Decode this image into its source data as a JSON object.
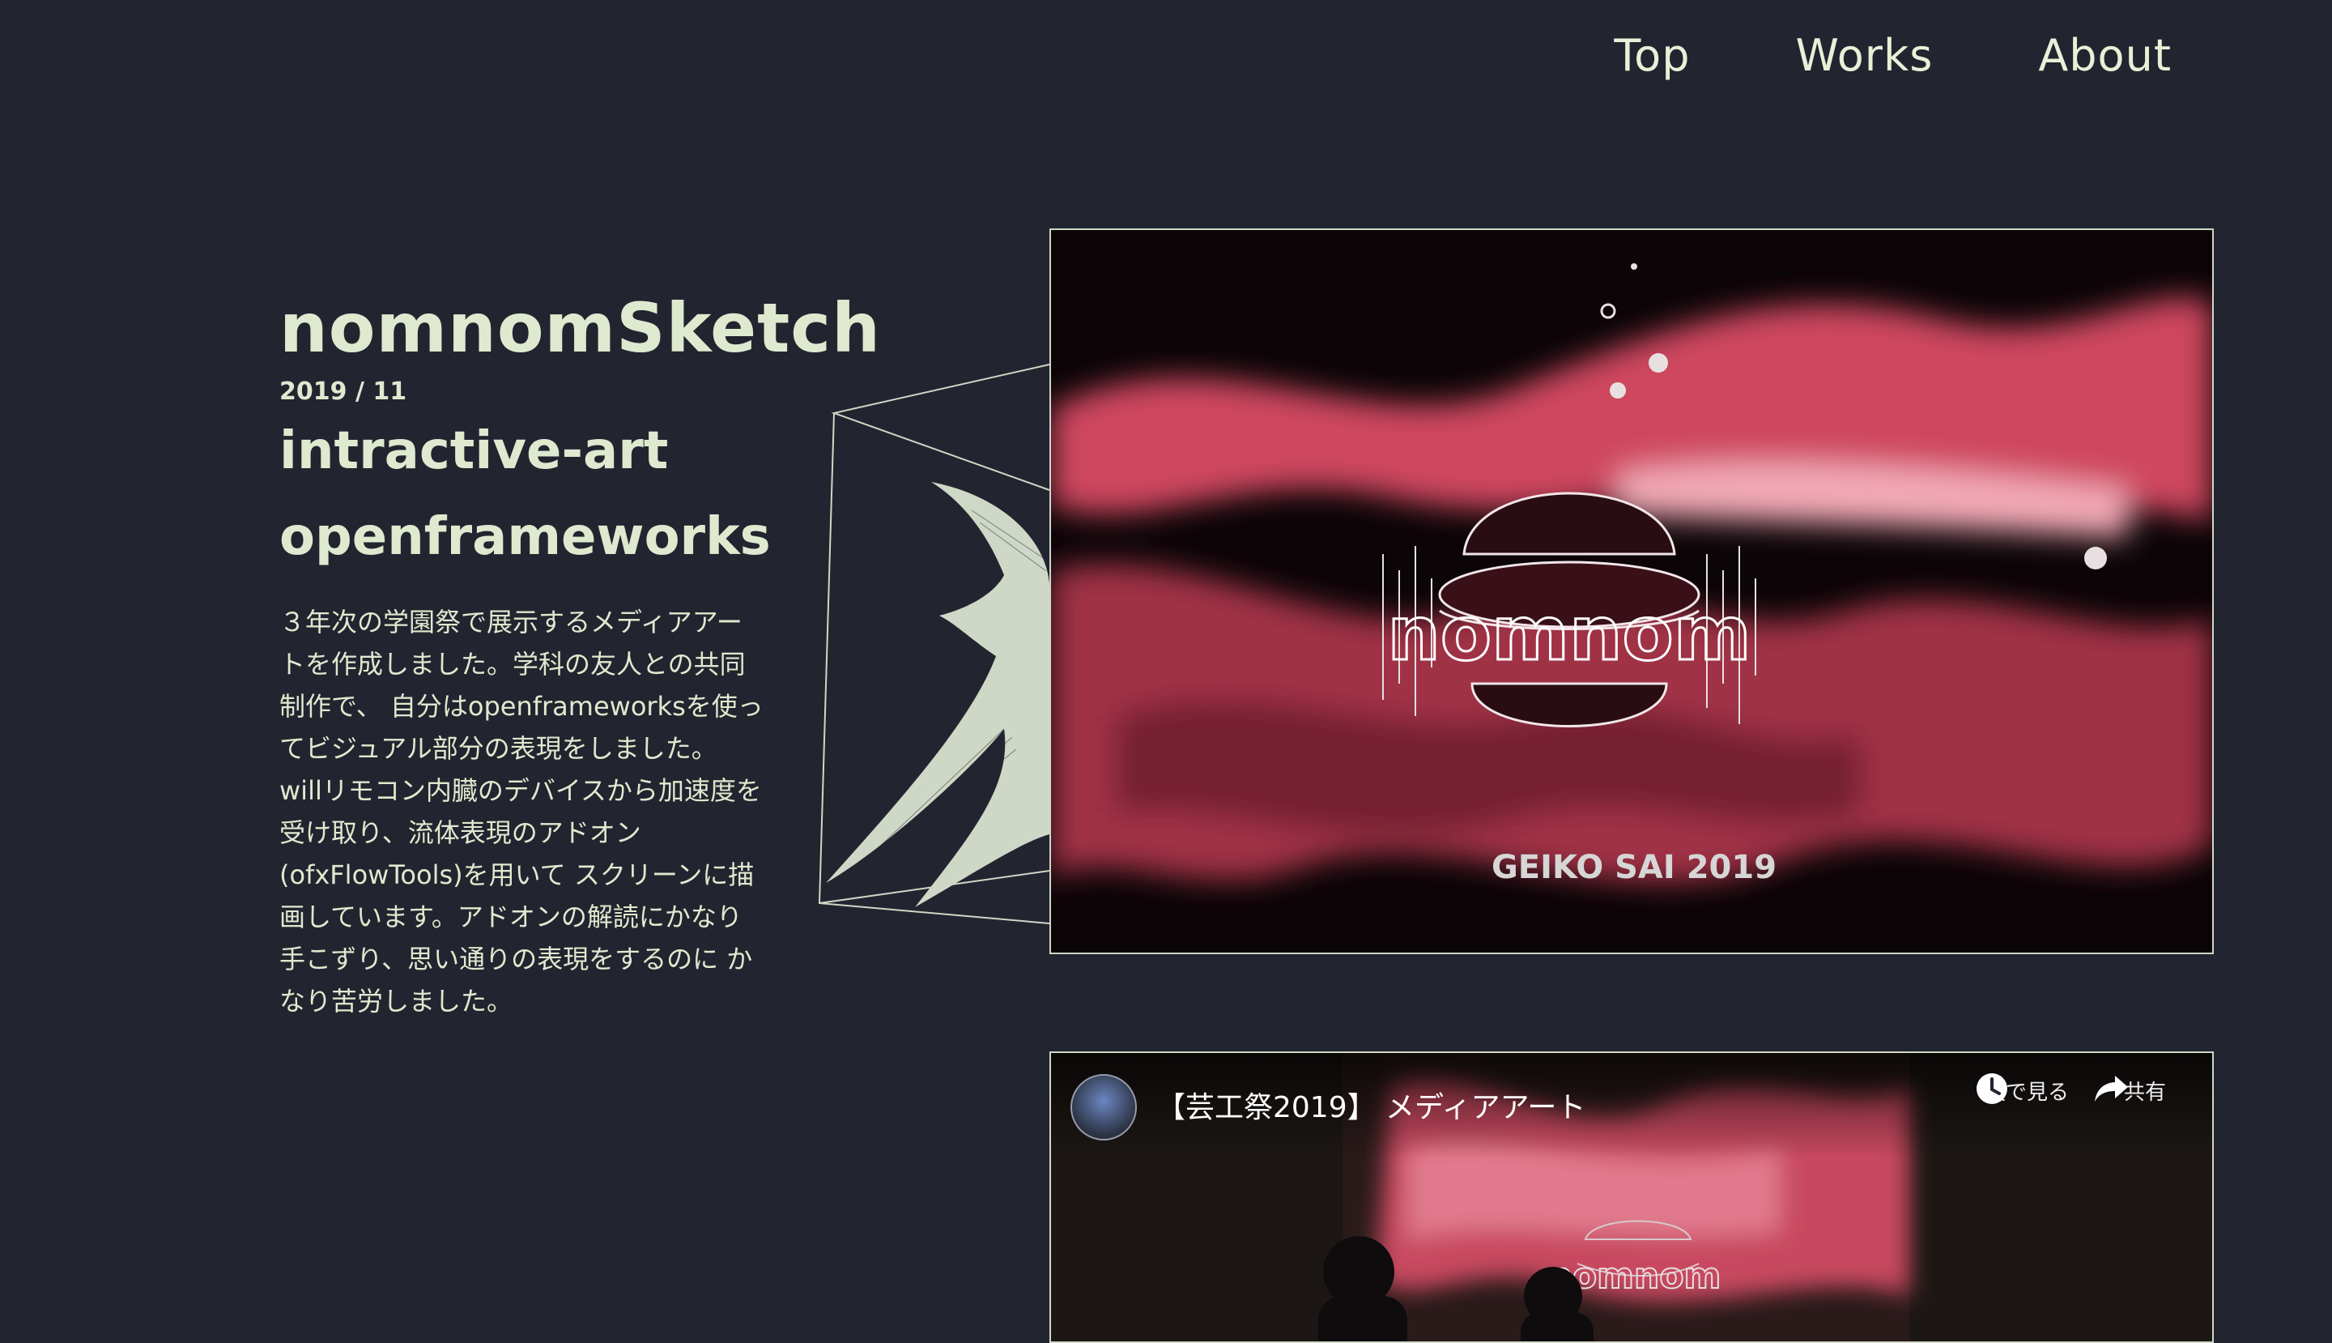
{
  "nav": {
    "items": [
      "Top",
      "Works",
      "About"
    ]
  },
  "work": {
    "title": "nomnomSketch",
    "date": "2019 / 11",
    "tags": [
      "intractive-art",
      "openframeworks"
    ],
    "description_lines": [
      "３年次の学園祭で展示するメディアアー",
      "トを作成しました。学科の友人との共同",
      "制作で、 自分はopenframeworksを使っ",
      "てビジュアル部分の表現をしました。",
      "willリモコン内臓のデバイスから加速度を",
      "受け取り、流体表現のアドオン",
      "(ofxFlowTools)を用いて スクリーンに描",
      "画しています。アドオンの解読にかなり",
      "手こずり、思い通りの表現をするのに か",
      "なり苦労しました。"
    ]
  },
  "hero": {
    "logo_text": "nomnom",
    "caption": "GEIKO SAI 2019"
  },
  "video": {
    "title": "【芸工祭2019】 メディアアート",
    "watch_later_label": "後で見る",
    "share_label": "共有",
    "overlay_logo_text": "nomnom"
  },
  "colors": {
    "background": "#22252f",
    "text": "#dfe9cf",
    "accent_pink": "#e0506a",
    "frame_border": "#cfd7c6"
  }
}
